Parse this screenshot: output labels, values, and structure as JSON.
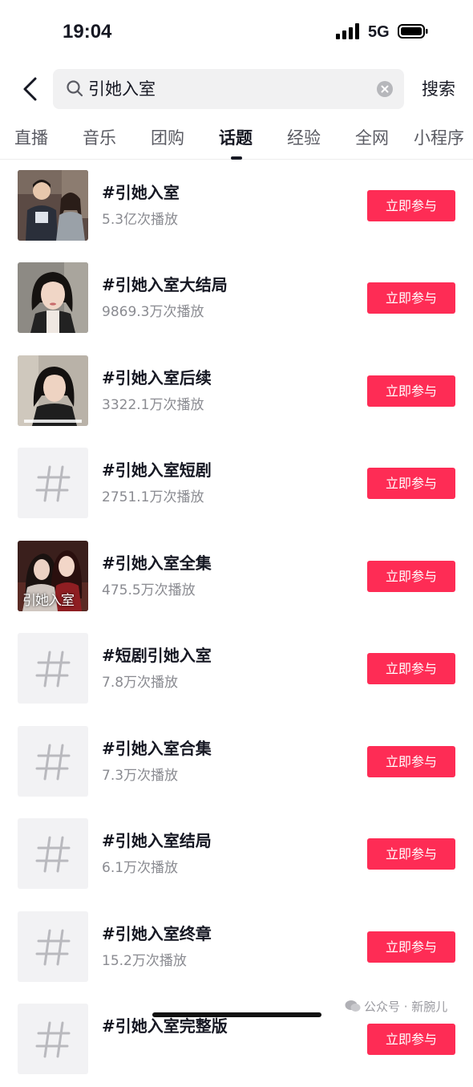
{
  "status_bar": {
    "time": "19:04",
    "network": "5G",
    "signal_icon": "signal-bars-icon",
    "battery_icon": "battery-icon"
  },
  "header": {
    "back_icon": "chevron-left-icon",
    "search_query": "引她入室",
    "search_icon": "search-icon",
    "clear_icon": "clear-circle-icon",
    "search_button": "搜索"
  },
  "tabs": [
    {
      "label": "直播"
    },
    {
      "label": "音乐"
    },
    {
      "label": "团购"
    },
    {
      "label": "话题",
      "active": true
    },
    {
      "label": "经验"
    },
    {
      "label": "全网"
    },
    {
      "label": "小程序"
    }
  ],
  "topics": [
    {
      "title": "#引她入室",
      "plays": "5.3亿次播放",
      "button": "立即参与",
      "thumb": "photo-couple"
    },
    {
      "title": "#引她入室大结局",
      "plays": "9869.3万次播放",
      "button": "立即参与",
      "thumb": "photo-woman"
    },
    {
      "title": "#引她入室后续",
      "plays": "3322.1万次播放",
      "button": "立即参与",
      "thumb": "photo-woman-subtitle"
    },
    {
      "title": "#引她入室短剧",
      "plays": "2751.1万次播放",
      "button": "立即参与",
      "thumb": "hashtag-icon"
    },
    {
      "title": "#引她入室全集",
      "plays": "475.5万次播放",
      "button": "立即参与",
      "thumb": "poster",
      "poster_text": "引她入室"
    },
    {
      "title": "#短剧引她入室",
      "plays": "7.8万次播放",
      "button": "立即参与",
      "thumb": "hashtag-icon"
    },
    {
      "title": "#引她入室合集",
      "plays": "7.3万次播放",
      "button": "立即参与",
      "thumb": "hashtag-icon"
    },
    {
      "title": "#引她入室结局",
      "plays": "6.1万次播放",
      "button": "立即参与",
      "thumb": "hashtag-icon"
    },
    {
      "title": "#引她入室终章",
      "plays": "15.2万次播放",
      "button": "立即参与",
      "thumb": "hashtag-icon"
    },
    {
      "title": "#引她入室完整版",
      "plays": "",
      "button": "立即参与",
      "thumb": "hashtag-icon"
    }
  ],
  "watermark": {
    "icon": "wechat-icon",
    "text": "公众号 · 新腕儿"
  },
  "colors": {
    "accent": "#fe2c55",
    "text": "#161823",
    "muted": "#8a8b91"
  }
}
